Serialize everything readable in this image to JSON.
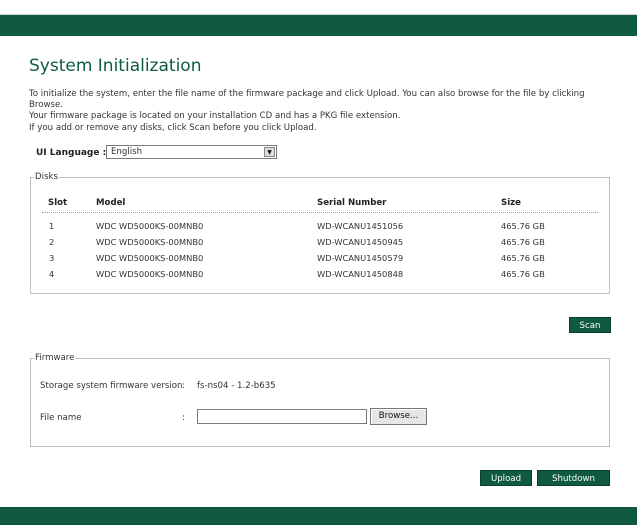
{
  "page": {
    "title": "System Initialization",
    "intro_line1": "To initialize the system, enter the file name of the firmware package and click Upload. You can also browse for the file by clicking Browse.",
    "intro_line2": "Your firmware package is located on your installation CD and has a PKG file extension.",
    "scan_note": "If you add or remove any disks, click Scan before you click Upload."
  },
  "language": {
    "label": "UI Language :",
    "selected": "English"
  },
  "disks": {
    "legend": "Disks",
    "columns": [
      "Slot",
      "Model",
      "Serial Number",
      "Size"
    ],
    "rows": [
      {
        "slot": "1",
        "model": "WDC WD5000KS-00MNB0",
        "serial": "WD-WCANU1451056",
        "size": "465.76 GB"
      },
      {
        "slot": "2",
        "model": "WDC WD5000KS-00MNB0",
        "serial": "WD-WCANU1450945",
        "size": "465.76 GB"
      },
      {
        "slot": "3",
        "model": "WDC WD5000KS-00MNB0",
        "serial": "WD-WCANU1450579",
        "size": "465.76 GB"
      },
      {
        "slot": "4",
        "model": "WDC WD5000KS-00MNB0",
        "serial": "WD-WCANU1450848",
        "size": "465.76 GB"
      }
    ]
  },
  "buttons": {
    "scan": "Scan",
    "upload": "Upload",
    "shutdown": "Shutdown",
    "browse": "Browse..."
  },
  "firmware": {
    "legend": "Firmware",
    "version_label": "Storage system firmware version",
    "separator": ":",
    "version_value": "fs-ns04 - 1.2-b635",
    "file_label": "File name",
    "file_value": ""
  },
  "colors": {
    "brand": "#0f5a41"
  },
  "icons": {
    "dropdown": "chevron-down-icon"
  }
}
